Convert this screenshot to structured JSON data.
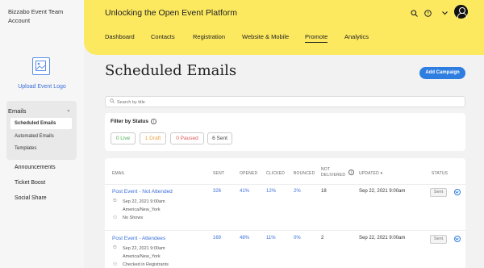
{
  "sidebar": {
    "account_name": "Bizzabo Event Team Account",
    "upload_logo_label": "Upload Event Logo",
    "emails_section": {
      "label": "Emails",
      "items": [
        {
          "label": "Scheduled Emails",
          "active": true
        },
        {
          "label": "Automated Emails",
          "active": false
        },
        {
          "label": "Templates",
          "active": false
        }
      ]
    },
    "nav": [
      {
        "label": "Announcements"
      },
      {
        "label": "Ticket Boost"
      },
      {
        "label": "Social Share"
      }
    ]
  },
  "header": {
    "event_title": "Unlocking the Open Event Platform",
    "tabs": [
      {
        "label": "Dashboard",
        "active": false
      },
      {
        "label": "Contacts",
        "active": false
      },
      {
        "label": "Registration",
        "active": false
      },
      {
        "label": "Website & Mobile",
        "active": false
      },
      {
        "label": "Promote",
        "active": true
      },
      {
        "label": "Analytics",
        "active": false
      }
    ],
    "icons": [
      "search-icon",
      "help-icon",
      "chevron-down-icon",
      "user-avatar-icon"
    ]
  },
  "main": {
    "title": "Scheduled Emails",
    "add_button": "Add Campaign",
    "search_placeholder": "Search by title",
    "filter": {
      "label": "Filter by Status",
      "chips": [
        {
          "label": "0 Live",
          "color": "#4caf50"
        },
        {
          "label": "1 Draft",
          "color": "#f0a040"
        },
        {
          "label": "0 Paused",
          "color": "#e05555"
        },
        {
          "label": "6 Sent",
          "color": "#444444"
        }
      ]
    },
    "table": {
      "headers": {
        "email": "EMAIL",
        "sent": "SENT",
        "opened": "OPENED",
        "clicked": "CLICKED",
        "bounced": "BOUNCED",
        "not_delivered": "NOT DELIVERED",
        "updated": "UPDATED ▾",
        "status": "STATUS"
      },
      "rows": [
        {
          "name": "Post Event - Not Attended",
          "date": "Sep 22, 2021 9:00am",
          "timezone": "America/New_York",
          "audience": "No Shows",
          "sent": "326",
          "opened": "41%",
          "clicked": "12%",
          "bounced": "2%",
          "not_delivered": "18",
          "updated": "Sep 22, 2021 9:00am",
          "status": "Sent"
        },
        {
          "name": "Post Event - Attendees",
          "date": "Sep 22, 2021 9:00am",
          "timezone": "America/New_York",
          "audience": "Checked in Registrants",
          "sent": "169",
          "opened": "48%",
          "clicked": "11%",
          "bounced": "0%",
          "not_delivered": "2",
          "updated": "Sep 22, 2021 9:00am",
          "status": "Sent"
        }
      ]
    }
  },
  "colors": {
    "header_yellow": "#fde960",
    "accent_blue": "#2e7de1",
    "link_blue": "#3a6fd8"
  }
}
